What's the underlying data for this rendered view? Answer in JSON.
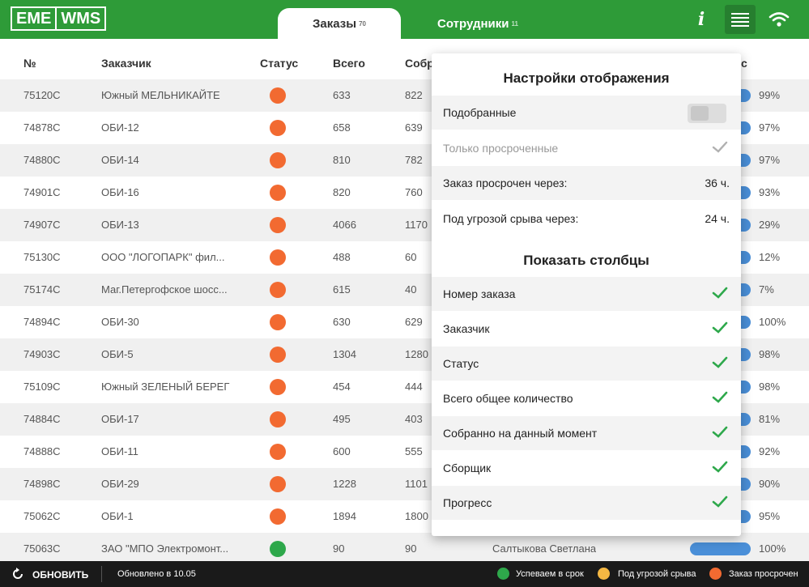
{
  "colors": {
    "green": "#2e9b38",
    "orange": "#f26a31",
    "yellow": "#f5b843",
    "status_green": "#2ea84b",
    "progress": "#4a8fd8"
  },
  "header": {
    "logo_left": "EME",
    "logo_right": "WMS",
    "tabs": [
      {
        "label": "Заказы",
        "count": "70"
      },
      {
        "label": "Сотрудники",
        "count": "11"
      }
    ],
    "info_label": "i"
  },
  "table": {
    "columns": {
      "number": "№",
      "customer": "Заказчик",
      "status": "Статус",
      "total": "Всего",
      "collected": "Собр",
      "progress": "c"
    },
    "rows": [
      {
        "number": "75120C",
        "customer": "Южный МЕЛЬНИКАЙТЕ",
        "status": "orange",
        "total": "633",
        "collected": "822",
        "picker": "",
        "progress": "99%",
        "progress_value": 0.99
      },
      {
        "number": "74878C",
        "customer": "ОБИ-12",
        "status": "orange",
        "total": "658",
        "collected": "639",
        "picker": "",
        "progress": "97%",
        "progress_value": 0.97
      },
      {
        "number": "74880C",
        "customer": "ОБИ-14",
        "status": "orange",
        "total": "810",
        "collected": "782",
        "picker": "",
        "progress": "97%",
        "progress_value": 0.97
      },
      {
        "number": "74901C",
        "customer": "ОБИ-16",
        "status": "orange",
        "total": "820",
        "collected": "760",
        "picker": "",
        "progress": "93%",
        "progress_value": 0.93
      },
      {
        "number": "74907C",
        "customer": "ОБИ-13",
        "status": "orange",
        "total": "4066",
        "collected": "1170",
        "picker": "",
        "progress": "29%",
        "progress_value": 0.29
      },
      {
        "number": "75130C",
        "customer": "ООО \"ЛОГОПАРК\" фил...",
        "status": "orange",
        "total": "488",
        "collected": "60",
        "picker": "",
        "progress": "12%",
        "progress_value": 0.12
      },
      {
        "number": "75174C",
        "customer": "Маг.Петергофское шосс...",
        "status": "orange",
        "total": "615",
        "collected": "40",
        "picker": "",
        "progress": "7%",
        "progress_value": 0.07
      },
      {
        "number": "74894C",
        "customer": "ОБИ-30",
        "status": "orange",
        "total": "630",
        "collected": "629",
        "picker": "",
        "progress": "100%",
        "progress_value": 1.0
      },
      {
        "number": "74903C",
        "customer": "ОБИ-5",
        "status": "orange",
        "total": "1304",
        "collected": "1280",
        "picker": "",
        "progress": "98%",
        "progress_value": 0.98
      },
      {
        "number": "75109C",
        "customer": "Южный ЗЕЛЕНЫЙ БЕРЕГ",
        "status": "orange",
        "total": "454",
        "collected": "444",
        "picker": "",
        "progress": "98%",
        "progress_value": 0.98
      },
      {
        "number": "74884C",
        "customer": "ОБИ-17",
        "status": "orange",
        "total": "495",
        "collected": "403",
        "picker": "",
        "progress": "81%",
        "progress_value": 0.81
      },
      {
        "number": "74888C",
        "customer": "ОБИ-11",
        "status": "orange",
        "total": "600",
        "collected": "555",
        "picker": "",
        "progress": "92%",
        "progress_value": 0.92
      },
      {
        "number": "74898C",
        "customer": "ОБИ-29",
        "status": "orange",
        "total": "1228",
        "collected": "1101",
        "picker": "",
        "progress": "90%",
        "progress_value": 0.9
      },
      {
        "number": "75062C",
        "customer": "ОБИ-1",
        "status": "orange",
        "total": "1894",
        "collected": "1800",
        "picker": "",
        "progress": "95%",
        "progress_value": 0.95
      },
      {
        "number": "75063C",
        "customer": "ЗАО \"МПО Электромонт...",
        "status": "green",
        "total": "90",
        "collected": "90",
        "picker": "Салтыкова Светлана",
        "progress": "100%",
        "progress_value": 1.0
      }
    ]
  },
  "popover": {
    "title": "Настройки отображения",
    "settings": [
      {
        "label": "Подобранные",
        "control": "toggle"
      },
      {
        "label": "Только просроченные",
        "control": "check-muted"
      },
      {
        "label": "Заказ просрочен через:",
        "value": "36 ч."
      },
      {
        "label": "Под угрозой срыва через:",
        "value": "24 ч."
      }
    ],
    "columns_title": "Показать столбцы",
    "columns": [
      "Номер заказа",
      "Заказчик",
      "Статус",
      "Всего общее количество",
      "Собранно на данный момент",
      "Сборщик",
      "Прогресс"
    ]
  },
  "footer": {
    "refresh_label": "ОБНОВИТЬ",
    "updated_text": "Обновлено в 10.05",
    "legend": [
      {
        "label": "Успеваем в срок",
        "color": "#2ea84b"
      },
      {
        "label": "Под угрозой срыва",
        "color": "#f5b843"
      },
      {
        "label": "Заказ просрочен",
        "color": "#f26a31"
      }
    ]
  }
}
